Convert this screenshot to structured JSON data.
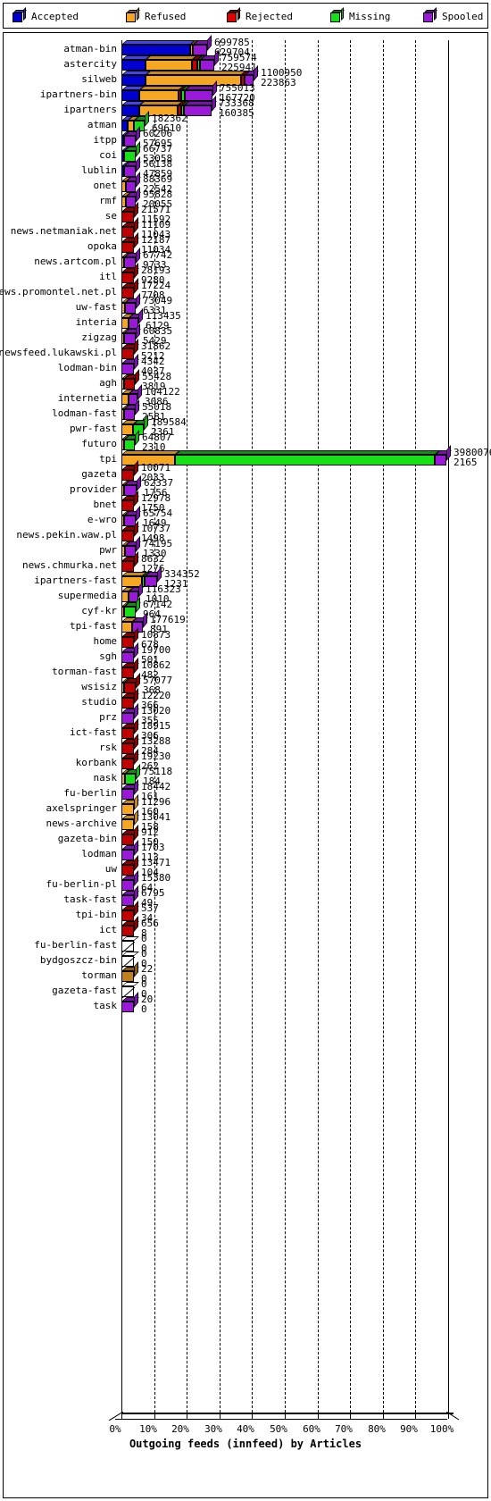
{
  "chart_data": {
    "type": "bar",
    "orientation": "horizontal",
    "stacked": true,
    "title": "",
    "xlabel": "Outgoing feeds (innfeed) by Articles",
    "ylabel": "",
    "xlim": [
      0,
      100
    ],
    "xunit": "%",
    "grid": true,
    "legend_position": "top",
    "xticks": [
      "0%",
      "10%",
      "20%",
      "30%",
      "40%",
      "50%",
      "60%",
      "70%",
      "80%",
      "90%",
      "100%"
    ],
    "series_names": [
      "Accepted",
      "Refused",
      "Rejected",
      "Missing",
      "Spooled"
    ],
    "series_colors": [
      "#0000d0",
      "#f5a623",
      "#e00000",
      "#18e018",
      "#9a18d8"
    ],
    "legend": [
      {
        "label": "Accepted",
        "color": "#0000d0"
      },
      {
        "label": "Refused",
        "color": "#f5a623"
      },
      {
        "label": "Rejected",
        "color": "#e00000"
      },
      {
        "label": "Missing",
        "color": "#18e018"
      },
      {
        "label": "Spooled",
        "color": "#9a18d8"
      }
    ],
    "note": "value_top = total offered, value_bottom = accepted-equivalent count; pct = bar total width as % of 100% axis; segments list fractional widths of the bar in series order",
    "categories": [
      {
        "label": "atman-bin",
        "top": "699785",
        "bottom": "629704",
        "pct": 26.5,
        "segments": [
          {
            "s": "Accepted",
            "f": 0.795
          },
          {
            "s": "Refused",
            "f": 0.035
          },
          {
            "s": "Spooled",
            "f": 0.17
          }
        ]
      },
      {
        "label": "astercity",
        "top": "759574",
        "bottom": "225941",
        "pct": 28.0,
        "segments": [
          {
            "s": "Accepted",
            "f": 0.265
          },
          {
            "s": "Refused",
            "f": 0.505
          },
          {
            "s": "Rejected",
            "f": 0.055
          },
          {
            "s": "Missing",
            "f": 0.02
          },
          {
            "s": "Spooled",
            "f": 0.155
          }
        ]
      },
      {
        "label": "silweb",
        "top": "1100950",
        "bottom": "223863",
        "pct": 40.5,
        "segments": [
          {
            "s": "Accepted",
            "f": 0.185
          },
          {
            "s": "Refused",
            "f": 0.72
          },
          {
            "s": "Rejected",
            "f": 0.025
          },
          {
            "s": "Spooled",
            "f": 0.07
          }
        ]
      },
      {
        "label": "ipartners-bin",
        "top": "755013",
        "bottom": "167720",
        "pct": 28.0,
        "segments": [
          {
            "s": "Accepted",
            "f": 0.2
          },
          {
            "s": "Refused",
            "f": 0.43
          },
          {
            "s": "Rejected",
            "f": 0.03
          },
          {
            "s": "Missing",
            "f": 0.035
          },
          {
            "s": "Spooled",
            "f": 0.305
          }
        ]
      },
      {
        "label": "ipartners",
        "top": "733368",
        "bottom": "160385",
        "pct": 27.2,
        "segments": [
          {
            "s": "Accepted",
            "f": 0.2
          },
          {
            "s": "Refused",
            "f": 0.43
          },
          {
            "s": "Rejected",
            "f": 0.035
          },
          {
            "s": "Missing",
            "f": 0.03
          },
          {
            "s": "Spooled",
            "f": 0.305
          }
        ]
      },
      {
        "label": "atman",
        "top": "182362",
        "bottom": "69610",
        "pct": 6.8,
        "segments": [
          {
            "s": "Accepted",
            "f": 0.27
          },
          {
            "s": "Refused",
            "f": 0.26
          },
          {
            "s": "Missing",
            "f": 0.47
          }
        ]
      },
      {
        "label": "itpp",
        "top": "60206",
        "bottom": "57695",
        "pct": 4.3,
        "segments": [
          {
            "s": "Accepted",
            "f": 0.18
          },
          {
            "s": "Spooled",
            "f": 0.82
          }
        ]
      },
      {
        "label": "coi",
        "top": "66737",
        "bottom": "53058",
        "pct": 4.3,
        "segments": [
          {
            "s": "Accepted",
            "f": 0.17
          },
          {
            "s": "Missing",
            "f": 0.83
          }
        ]
      },
      {
        "label": "lublin",
        "top": "56138",
        "bottom": "47859",
        "pct": 4.3,
        "segments": [
          {
            "s": "Accepted",
            "f": 0.18
          },
          {
            "s": "Spooled",
            "f": 0.82
          }
        ]
      },
      {
        "label": "onet",
        "top": "88369",
        "bottom": "22542",
        "pct": 4.5,
        "segments": [
          {
            "s": "Refused",
            "f": 0.33
          },
          {
            "s": "Spooled",
            "f": 0.67
          }
        ]
      },
      {
        "label": "rmf",
        "top": "95828",
        "bottom": "20055",
        "pct": 4.5,
        "segments": [
          {
            "s": "Refused",
            "f": 0.33
          },
          {
            "s": "Spooled",
            "f": 0.67
          }
        ]
      },
      {
        "label": "se",
        "top": "21571",
        "bottom": "11592",
        "pct": 3.3,
        "segments": [
          {
            "s": "Rejected",
            "f": 1.0
          }
        ]
      },
      {
        "label": "news.netmaniak.net",
        "top": "11109",
        "bottom": "11043",
        "pct": 3.3,
        "segments": [
          {
            "s": "Rejected",
            "f": 1.0
          }
        ]
      },
      {
        "label": "opoka",
        "top": "12187",
        "bottom": "11034",
        "pct": 3.3,
        "segments": [
          {
            "s": "Rejected",
            "f": 1.0
          }
        ]
      },
      {
        "label": "news.artcom.pl",
        "top": "67742",
        "bottom": "9733",
        "pct": 4.3,
        "segments": [
          {
            "s": "Refused",
            "f": 0.2
          },
          {
            "s": "Spooled",
            "f": 0.8
          }
        ]
      },
      {
        "label": "itl",
        "top": "28193",
        "bottom": "9280",
        "pct": 3.3,
        "segments": [
          {
            "s": "Rejected",
            "f": 1.0
          }
        ]
      },
      {
        "label": "news.promontel.net.pl",
        "top": "17224",
        "bottom": "7708",
        "pct": 3.3,
        "segments": [
          {
            "s": "Rejected",
            "f": 1.0
          }
        ]
      },
      {
        "label": "uw-fast",
        "top": "73049",
        "bottom": "6331",
        "pct": 4.3,
        "segments": [
          {
            "s": "Refused",
            "f": 0.26
          },
          {
            "s": "Spooled",
            "f": 0.74
          }
        ]
      },
      {
        "label": "interia",
        "top": "113435",
        "bottom": "6129",
        "pct": 5.2,
        "segments": [
          {
            "s": "Refused",
            "f": 0.42
          },
          {
            "s": "Spooled",
            "f": 0.58
          }
        ]
      },
      {
        "label": "zigzag",
        "top": "60835",
        "bottom": "5429",
        "pct": 4.3,
        "segments": [
          {
            "s": "Refused",
            "f": 0.2
          },
          {
            "s": "Spooled",
            "f": 0.8
          }
        ]
      },
      {
        "label": "newsfeed.lukawski.pl",
        "top": "31862",
        "bottom": "5212",
        "pct": 3.6,
        "segments": [
          {
            "s": "Rejected",
            "f": 1.0
          }
        ]
      },
      {
        "label": "lodman-bin",
        "top": "4342",
        "bottom": "4037",
        "pct": 3.3,
        "segments": [
          {
            "s": "Spooled",
            "f": 1.0
          }
        ]
      },
      {
        "label": "agh",
        "top": "55428",
        "bottom": "3819",
        "pct": 3.9,
        "segments": [
          {
            "s": "Refused",
            "f": 0.14
          },
          {
            "s": "Rejected",
            "f": 0.86
          }
        ]
      },
      {
        "label": "internetia",
        "top": "104122",
        "bottom": "3086",
        "pct": 4.9,
        "segments": [
          {
            "s": "Refused",
            "f": 0.42
          },
          {
            "s": "Spooled",
            "f": 0.58
          }
        ]
      },
      {
        "label": "lodman-fast",
        "top": "55018",
        "bottom": "2581",
        "pct": 3.9,
        "segments": [
          {
            "s": "Refused",
            "f": 0.12
          },
          {
            "s": "Spooled",
            "f": 0.88
          }
        ]
      },
      {
        "label": "pwr-fast",
        "top": "189584",
        "bottom": "2361",
        "pct": 6.8,
        "segments": [
          {
            "s": "Refused",
            "f": 0.52
          },
          {
            "s": "Missing",
            "f": 0.48
          }
        ]
      },
      {
        "label": "futuro",
        "top": "64807",
        "bottom": "2310",
        "pct": 4.0,
        "segments": [
          {
            "s": "Refused",
            "f": 0.17
          },
          {
            "s": "Missing",
            "f": 0.83
          }
        ]
      },
      {
        "label": "tpi",
        "top": "3980076",
        "bottom": "2165",
        "pct": 99.5,
        "segments": [
          {
            "s": "Refused",
            "f": 0.165
          },
          {
            "s": "Missing",
            "f": 0.8
          },
          {
            "s": "Spooled",
            "f": 0.035
          }
        ]
      },
      {
        "label": "gazeta",
        "top": "10071",
        "bottom": "2033",
        "pct": 3.3,
        "segments": [
          {
            "s": "Rejected",
            "f": 1.0
          }
        ]
      },
      {
        "label": "provider",
        "top": "62337",
        "bottom": "1756",
        "pct": 4.3,
        "segments": [
          {
            "s": "Refused",
            "f": 0.15
          },
          {
            "s": "Spooled",
            "f": 0.85
          }
        ]
      },
      {
        "label": "bnet",
        "top": "12978",
        "bottom": "1750",
        "pct": 3.3,
        "segments": [
          {
            "s": "Rejected",
            "f": 1.0
          }
        ]
      },
      {
        "label": "e-wro",
        "top": "65754",
        "bottom": "1649",
        "pct": 4.3,
        "segments": [
          {
            "s": "Refused",
            "f": 0.18
          },
          {
            "s": "Spooled",
            "f": 0.82
          }
        ]
      },
      {
        "label": "news.pekin.waw.pl",
        "top": "10737",
        "bottom": "1498",
        "pct": 3.3,
        "segments": [
          {
            "s": "Rejected",
            "f": 1.0
          }
        ]
      },
      {
        "label": "pwr",
        "top": "74195",
        "bottom": "1330",
        "pct": 4.4,
        "segments": [
          {
            "s": "Refused",
            "f": 0.26
          },
          {
            "s": "Spooled",
            "f": 0.74
          }
        ]
      },
      {
        "label": "news.chmurka.net",
        "top": "8632",
        "bottom": "1276",
        "pct": 3.3,
        "segments": [
          {
            "s": "Rejected",
            "f": 1.0
          }
        ]
      },
      {
        "label": "ipartners-fast",
        "top": "334352",
        "bottom": "1231",
        "pct": 10.6,
        "segments": [
          {
            "s": "Refused",
            "f": 0.6
          },
          {
            "s": "Missing",
            "f": 0.05
          },
          {
            "s": "Spooled",
            "f": 0.35
          }
        ]
      },
      {
        "label": "supermedia",
        "top": "116323",
        "bottom": "1010",
        "pct": 5.3,
        "segments": [
          {
            "s": "Refused",
            "f": 0.4
          },
          {
            "s": "Spooled",
            "f": 0.6
          }
        ]
      },
      {
        "label": "cyf-kr",
        "top": "67142",
        "bottom": "964",
        "pct": 4.3,
        "segments": [
          {
            "s": "Refused",
            "f": 0.19
          },
          {
            "s": "Missing",
            "f": 0.81
          }
        ]
      },
      {
        "label": "tpi-fast",
        "top": "177619",
        "bottom": "891",
        "pct": 6.6,
        "segments": [
          {
            "s": "Refused",
            "f": 0.49
          },
          {
            "s": "Spooled",
            "f": 0.51
          }
        ]
      },
      {
        "label": "home",
        "top": "10873",
        "bottom": "678",
        "pct": 3.3,
        "segments": [
          {
            "s": "Rejected",
            "f": 1.0
          }
        ]
      },
      {
        "label": "sgh",
        "top": "19700",
        "bottom": "501",
        "pct": 3.3,
        "segments": [
          {
            "s": "Spooled",
            "f": 1.0
          }
        ]
      },
      {
        "label": "torman-fast",
        "top": "10862",
        "bottom": "482",
        "pct": 3.3,
        "segments": [
          {
            "s": "Rejected",
            "f": 1.0
          }
        ]
      },
      {
        "label": "wsisiz",
        "top": "57077",
        "bottom": "368",
        "pct": 4.1,
        "segments": [
          {
            "s": "Refused",
            "f": 0.14
          },
          {
            "s": "Rejected",
            "f": 0.86
          }
        ]
      },
      {
        "label": "studio",
        "top": "12220",
        "bottom": "366",
        "pct": 3.3,
        "segments": [
          {
            "s": "Rejected",
            "f": 1.0
          }
        ]
      },
      {
        "label": "prz",
        "top": "13020",
        "bottom": "355",
        "pct": 3.3,
        "segments": [
          {
            "s": "Spooled",
            "f": 1.0
          }
        ]
      },
      {
        "label": "ict-fast",
        "top": "18915",
        "bottom": "306",
        "pct": 3.3,
        "segments": [
          {
            "s": "Rejected",
            "f": 1.0
          }
        ]
      },
      {
        "label": "rsk",
        "top": "13288",
        "bottom": "284",
        "pct": 3.3,
        "segments": [
          {
            "s": "Rejected",
            "f": 1.0
          }
        ]
      },
      {
        "label": "korbank",
        "top": "19230",
        "bottom": "262",
        "pct": 3.3,
        "segments": [
          {
            "s": "Rejected",
            "f": 1.0
          }
        ]
      },
      {
        "label": "nask",
        "top": "75118",
        "bottom": "184",
        "pct": 4.4,
        "segments": [
          {
            "s": "Refused",
            "f": 0.22
          },
          {
            "s": "Missing",
            "f": 0.78
          }
        ]
      },
      {
        "label": "fu-berlin",
        "top": "18442",
        "bottom": "161",
        "pct": 3.3,
        "segments": [
          {
            "s": "Spooled",
            "f": 1.0
          }
        ]
      },
      {
        "label": "axelspringer",
        "top": "11296",
        "bottom": "160",
        "pct": 3.3,
        "segments": [
          {
            "s": "Refused",
            "f": 1.0
          }
        ]
      },
      {
        "label": "news-archive",
        "top": "13041",
        "bottom": "158",
        "pct": 3.3,
        "segments": [
          {
            "s": "Refused",
            "f": 1.0
          }
        ]
      },
      {
        "label": "gazeta-bin",
        "top": "912",
        "bottom": "150",
        "pct": 3.3,
        "segments": [
          {
            "s": "Rejected",
            "f": 1.0
          }
        ]
      },
      {
        "label": "lodman",
        "top": "1703",
        "bottom": "113",
        "pct": 3.3,
        "segments": [
          {
            "s": "Spooled",
            "f": 1.0
          }
        ]
      },
      {
        "label": "uw",
        "top": "13471",
        "bottom": "104",
        "pct": 3.3,
        "segments": [
          {
            "s": "Rejected",
            "f": 1.0
          }
        ]
      },
      {
        "label": "fu-berlin-pl",
        "top": "15380",
        "bottom": "64",
        "pct": 3.3,
        "segments": [
          {
            "s": "Spooled",
            "f": 1.0
          }
        ]
      },
      {
        "label": "task-fast",
        "top": "6795",
        "bottom": "49",
        "pct": 3.3,
        "segments": [
          {
            "s": "Spooled",
            "f": 1.0
          }
        ]
      },
      {
        "label": "tpi-bin",
        "top": "537",
        "bottom": "34",
        "pct": 3.3,
        "segments": [
          {
            "s": "Rejected",
            "f": 1.0
          }
        ]
      },
      {
        "label": "ict",
        "top": "656",
        "bottom": "8",
        "pct": 3.3,
        "segments": [
          {
            "s": "Rejected",
            "f": 1.0
          }
        ]
      },
      {
        "label": "fu-berlin-fast",
        "top": "0",
        "bottom": "0",
        "pct": 3.3,
        "segments": []
      },
      {
        "label": "bydgoszcz-bin",
        "top": "0",
        "bottom": "0",
        "pct": 3.3,
        "segments": []
      },
      {
        "label": "torman",
        "top": "22",
        "bottom": "0",
        "pct": 3.3,
        "segments": [
          {
            "s": "RefusedDark",
            "f": 1.0
          }
        ]
      },
      {
        "label": "gazeta-fast",
        "top": "0",
        "bottom": "0",
        "pct": 3.3,
        "segments": []
      },
      {
        "label": "task",
        "top": "20",
        "bottom": "0",
        "pct": 3.3,
        "segments": [
          {
            "s": "Spooled",
            "f": 1.0
          }
        ]
      }
    ]
  }
}
